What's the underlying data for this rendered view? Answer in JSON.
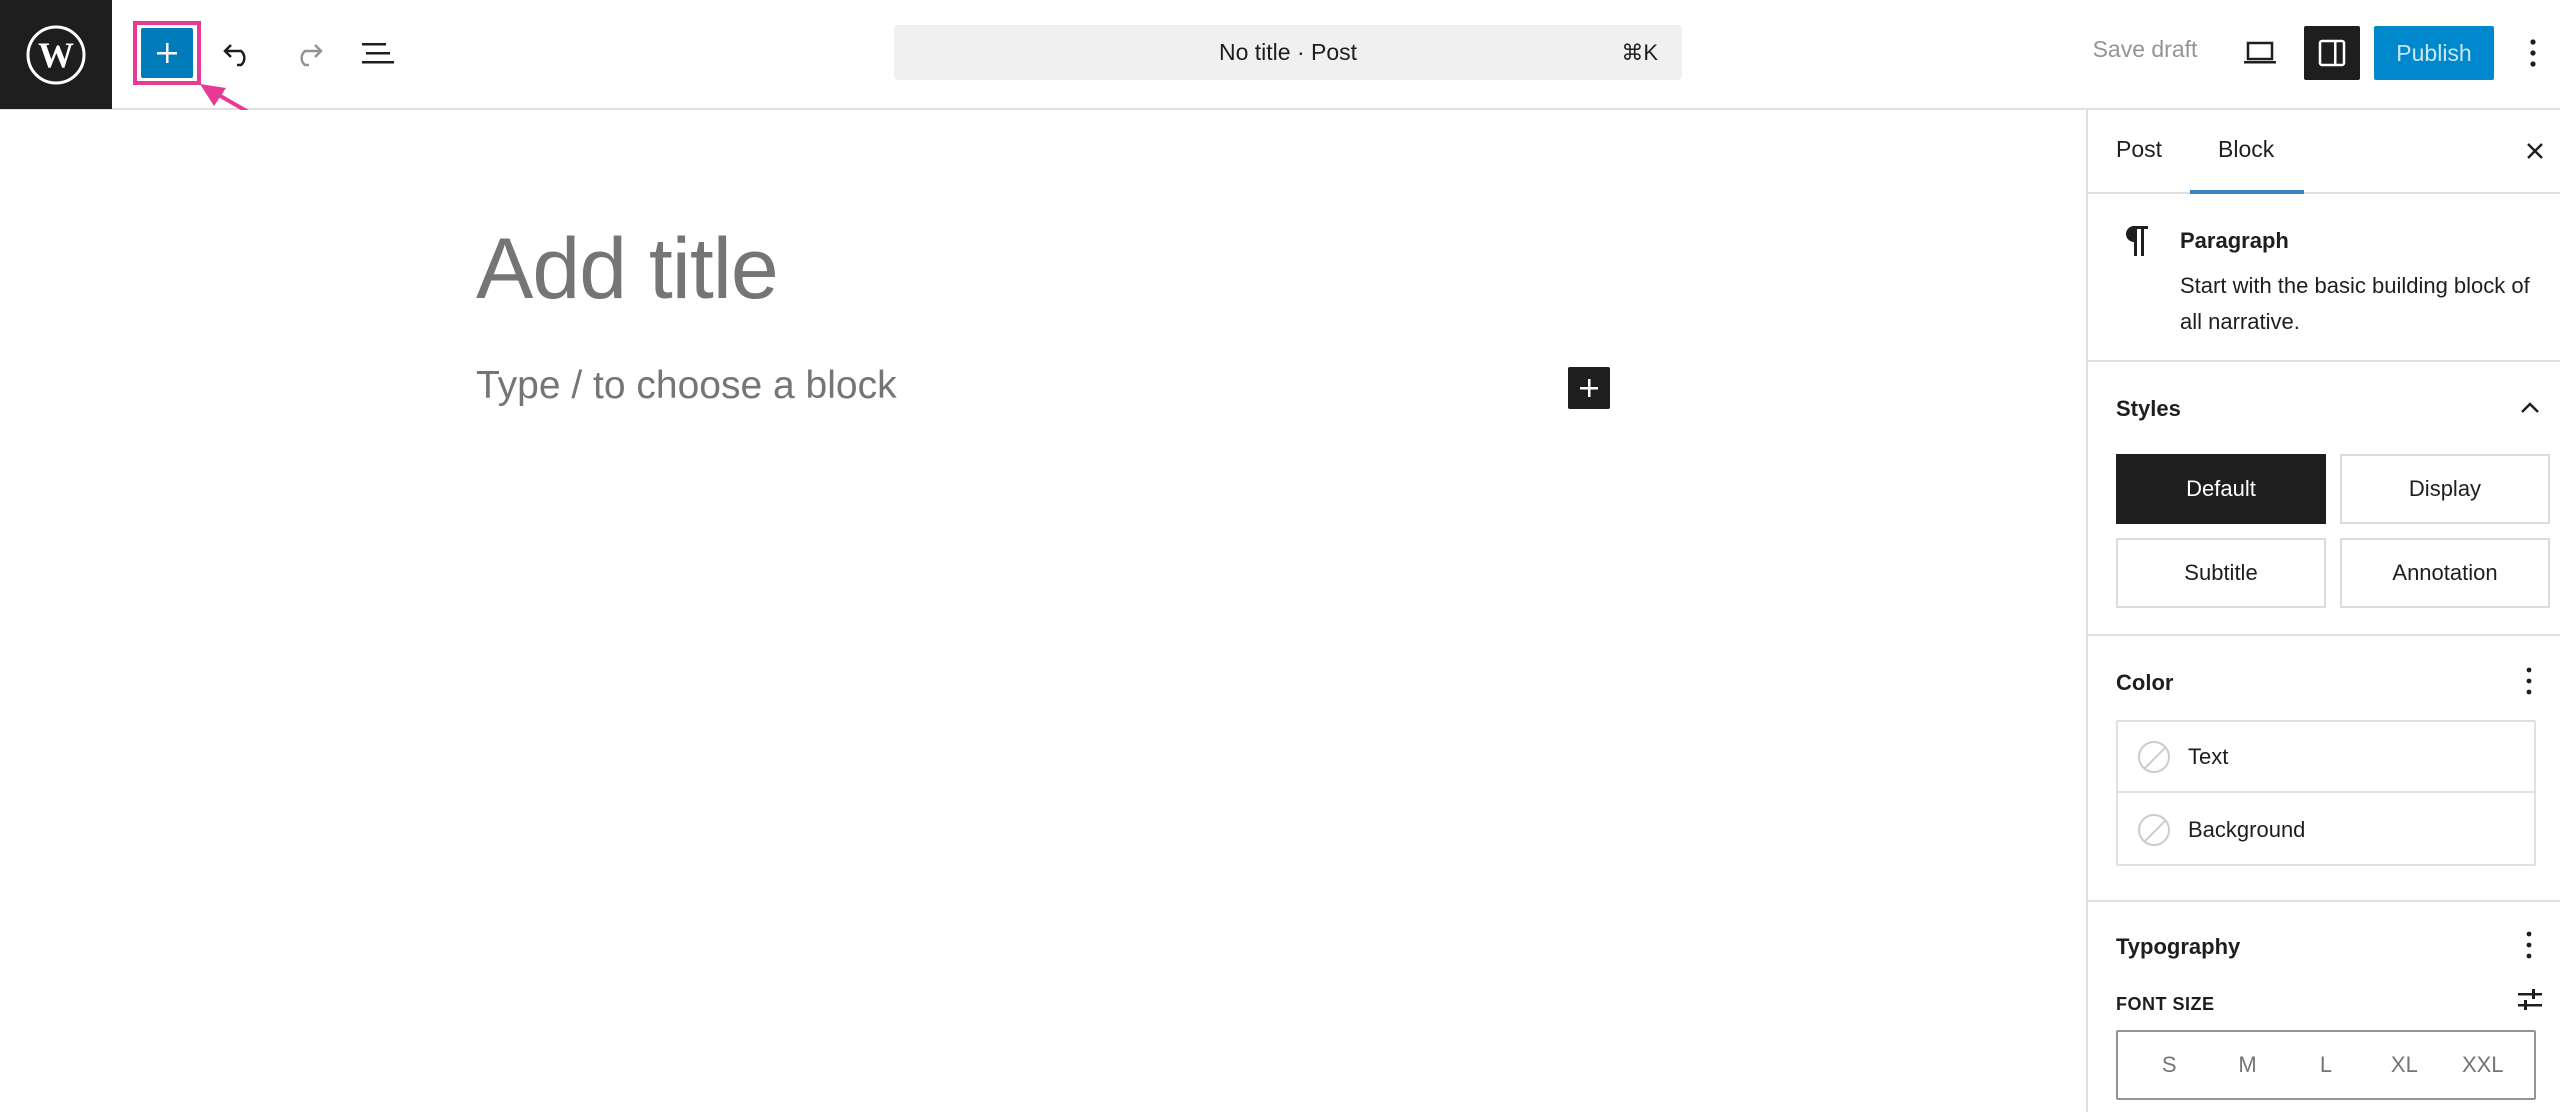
{
  "colors": {
    "accent": "#007cba",
    "highlight": "#e63a94",
    "dark": "#1e1e1e"
  },
  "header": {
    "logo_icon": "wordpress-logo-icon",
    "document_title": "No title · Post",
    "shortcut": "⌘K",
    "save_draft": "Save draft",
    "publish": "Publish"
  },
  "editor": {
    "title_placeholder": "Add title",
    "block_placeholder": "Type / to choose a block"
  },
  "sidebar": {
    "tabs": [
      {
        "label": "Post"
      },
      {
        "label": "Block"
      }
    ],
    "block": {
      "name": "Paragraph",
      "description": "Start with the basic building block of all narrative."
    },
    "styles": {
      "heading": "Styles",
      "options": [
        {
          "label": "Default",
          "active": true
        },
        {
          "label": "Display",
          "active": false
        },
        {
          "label": "Subtitle",
          "active": false
        },
        {
          "label": "Annotation",
          "active": false
        }
      ]
    },
    "color": {
      "heading": "Color",
      "items": [
        {
          "label": "Text"
        },
        {
          "label": "Background"
        }
      ]
    },
    "typography": {
      "heading": "Typography",
      "font_size_label": "FONT SIZE",
      "sizes": [
        "S",
        "M",
        "L",
        "XL",
        "XXL"
      ]
    }
  }
}
